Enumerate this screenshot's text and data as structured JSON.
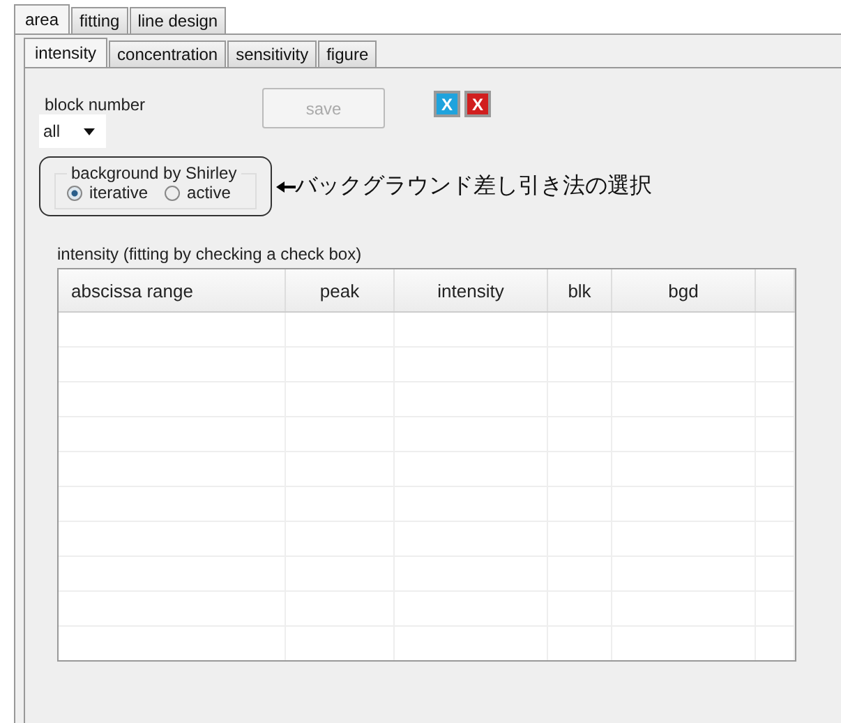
{
  "outer_tabs": [
    {
      "label": "area",
      "selected": true
    },
    {
      "label": "fitting",
      "selected": false
    },
    {
      "label": "line design",
      "selected": false
    }
  ],
  "inner_tabs": [
    {
      "label": "intensity",
      "selected": true
    },
    {
      "label": "concentration",
      "selected": false
    },
    {
      "label": "sensitivity",
      "selected": false
    },
    {
      "label": "figure",
      "selected": false
    }
  ],
  "block_number": {
    "label": "block number",
    "value": "all"
  },
  "save_button": {
    "label": "save",
    "disabled": true
  },
  "mark_buttons": [
    {
      "label": "X",
      "color": "#1fa3dd"
    },
    {
      "label": "X",
      "color": "#d11f1f"
    }
  ],
  "background": {
    "title": "background by Shirley",
    "options": [
      {
        "label": "iterative",
        "selected": true
      },
      {
        "label": "active",
        "selected": false
      }
    ]
  },
  "annotation": "バックグラウンド差し引き法の選択",
  "table": {
    "title": "intensity (fitting by checking a check box)",
    "columns": [
      "abscissa range",
      "peak",
      "intensity",
      "blk",
      "bgd"
    ]
  }
}
